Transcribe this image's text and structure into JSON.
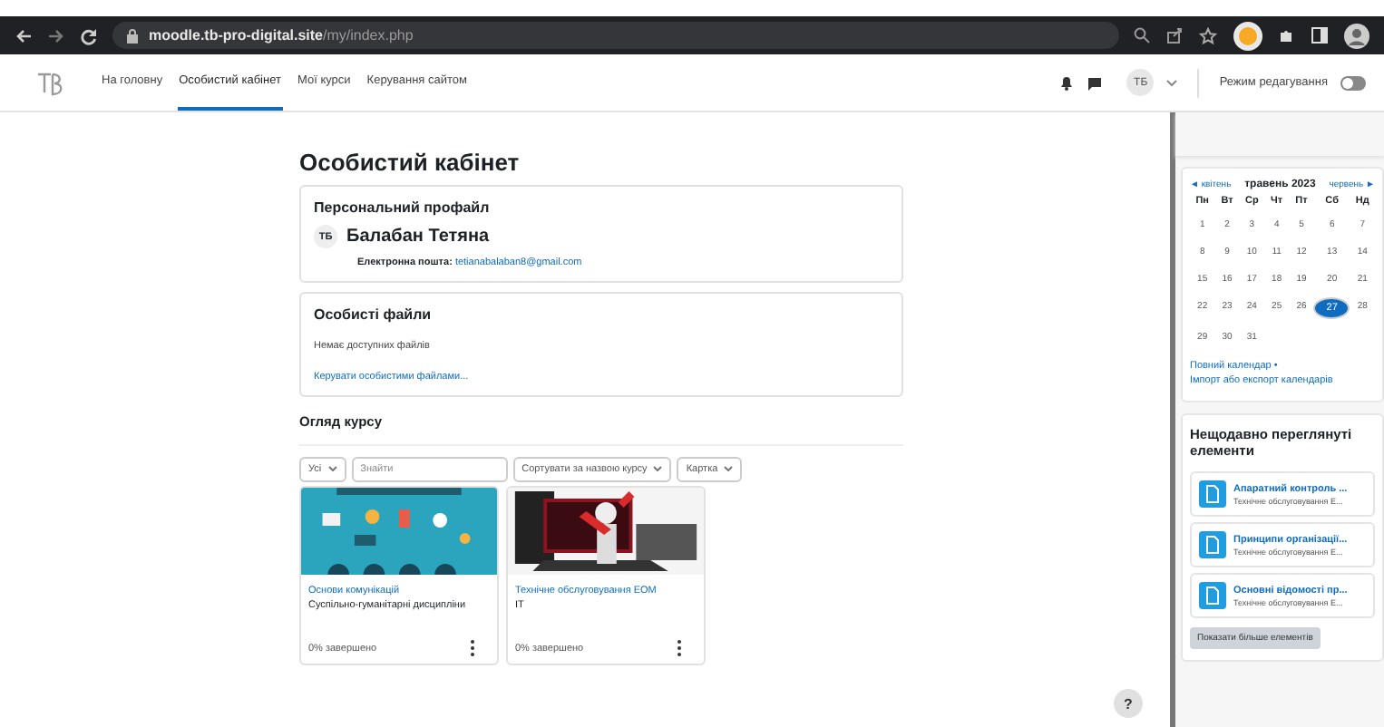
{
  "browser": {
    "url_host": "moodle.tb-pro-digital.site",
    "url_path": "/my/index.php"
  },
  "nav": {
    "items": [
      {
        "label": "На головну",
        "selected": false
      },
      {
        "label": "Особистий кабінет",
        "selected": true
      },
      {
        "label": "Мої курси",
        "selected": false
      },
      {
        "label": "Керування сайтом",
        "selected": false
      }
    ],
    "user_initials": "ТБ",
    "edit_mode": {
      "label": "Режим редагування",
      "on": false
    }
  },
  "page_title": "Особистий кабінет",
  "profile": {
    "title": "Персональний профайл",
    "initials": "ТБ",
    "name": "Балабан Тетяна",
    "email_label": "Електронна пошта:",
    "email": "tetianabalaban8@gmail.com"
  },
  "files": {
    "title": "Особисті файли",
    "empty": "Немає доступних файлів",
    "manage_link": "Керувати особистими файлами..."
  },
  "course_overview": {
    "title": "Огляд курсу",
    "filter": "Усі",
    "search": {
      "placeholder": "Знайти"
    },
    "sort": "Сортувати за назвою курсу",
    "view": "Картка",
    "courses": [
      {
        "name": "Основи комунікацій",
        "category": "Суспільно-гуманітарні дисципліни",
        "progress": "0% завершено",
        "kind": "picture"
      },
      {
        "name": "Технічне обслуговування ЕОМ",
        "category": "IT",
        "progress": "0% завершено",
        "kind": "picture"
      }
    ]
  },
  "calendar": {
    "prev": "◄ квітень",
    "month": "травень 2023",
    "next": "червень ►",
    "weekdays": [
      "Пн",
      "Вт",
      "Ср",
      "Чт",
      "Пт",
      "Сб",
      "Нд"
    ],
    "days": [
      {
        "day": "1",
        "selected": false
      },
      {
        "day": "2",
        "selected": false
      },
      {
        "day": "3",
        "selected": false
      },
      {
        "day": "4",
        "selected": false
      },
      {
        "day": "5",
        "selected": false
      },
      {
        "day": "6",
        "selected": false
      },
      {
        "day": "7",
        "selected": false
      },
      {
        "day": "8",
        "selected": false
      },
      {
        "day": "9",
        "selected": false
      },
      {
        "day": "10",
        "selected": false
      },
      {
        "day": "11",
        "selected": false
      },
      {
        "day": "12",
        "selected": false
      },
      {
        "day": "13",
        "selected": false
      },
      {
        "day": "14",
        "selected": false
      },
      {
        "day": "15",
        "selected": false
      },
      {
        "day": "16",
        "selected": false
      },
      {
        "day": "17",
        "selected": false
      },
      {
        "day": "18",
        "selected": false
      },
      {
        "day": "19",
        "selected": false
      },
      {
        "day": "20",
        "selected": false
      },
      {
        "day": "21",
        "selected": false
      },
      {
        "day": "22",
        "selected": false
      },
      {
        "day": "23",
        "selected": false
      },
      {
        "day": "24",
        "selected": false
      },
      {
        "day": "25",
        "selected": false
      },
      {
        "day": "26",
        "selected": false
      },
      {
        "day": "27",
        "selected": true
      },
      {
        "day": "28",
        "selected": false
      },
      {
        "day": "29",
        "selected": false
      },
      {
        "day": "30",
        "selected": false
      },
      {
        "day": "31",
        "selected": false
      }
    ],
    "full_link": "Повний календар",
    "separator": "•",
    "export_link": "Імпорт або експорт календарів"
  },
  "recent": {
    "title": "Нещодавно переглянуті елементи",
    "items": [
      {
        "title": "Апаратний контроль ...",
        "subtitle": "Технічне обслуговування Е..."
      },
      {
        "title": "Принципи організації...",
        "subtitle": "Технічне обслуговування Е..."
      },
      {
        "title": "Основні відомості пр...",
        "subtitle": "Технічне обслуговування Е..."
      }
    ],
    "more_button": "Показати більше елементів"
  },
  "help_button": "?"
}
